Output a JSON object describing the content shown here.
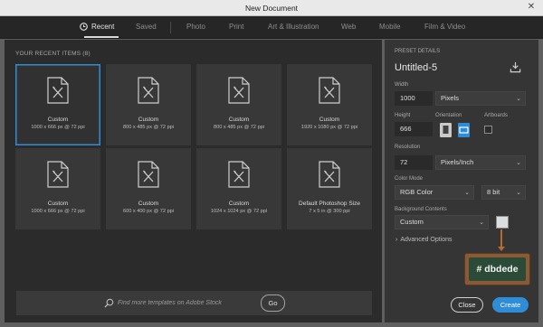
{
  "window": {
    "title": "New Document",
    "close_glyph": "✕"
  },
  "tabs": [
    {
      "label": "Recent",
      "icon": "clock-icon",
      "active": true
    },
    {
      "label": "Saved"
    },
    {
      "label": "Photo"
    },
    {
      "label": "Print"
    },
    {
      "label": "Art & Illustration"
    },
    {
      "label": "Web"
    },
    {
      "label": "Mobile"
    },
    {
      "label": "Film & Video"
    }
  ],
  "recent": {
    "header": "YOUR RECENT ITEMS  (8)",
    "items": [
      {
        "name": "Custom",
        "details": "1000 x 666 px @ 72 ppi",
        "selected": true,
        "icon": "document-icon"
      },
      {
        "name": "Custom",
        "details": "800 x 485 px @ 72 ppi",
        "icon": "document-icon"
      },
      {
        "name": "Custom",
        "details": "800 x 485 px @ 72 ppi",
        "icon": "document-icon"
      },
      {
        "name": "Custom",
        "details": "1920 x 1080 px @ 72 ppi",
        "icon": "document-icon"
      },
      {
        "name": "Custom",
        "details": "1000 x 666 px @ 72 ppi",
        "icon": "document-icon"
      },
      {
        "name": "Custom",
        "details": "600 x 400 px @ 72 ppi",
        "icon": "document-icon"
      },
      {
        "name": "Custom",
        "details": "1024 x 1024 px @ 72 ppi",
        "icon": "document-icon"
      },
      {
        "name": "Default Photoshop Size",
        "details": "7 x 5 in @ 300 ppi",
        "icon": "document-icon"
      }
    ]
  },
  "search": {
    "placeholder": "Find more templates on Adobe Stock",
    "value": "",
    "go_label": "Go"
  },
  "preset": {
    "section_label": "PRESET DETAILS",
    "name": "Untitled-5",
    "width_label": "Width",
    "width_value": "1000",
    "width_unit": "Pixels",
    "height_label": "Height",
    "height_value": "666",
    "orientation_label": "Orientation",
    "artboards_label": "Artboards",
    "resolution_label": "Resolution",
    "resolution_value": "72",
    "resolution_unit": "Pixels/Inch",
    "color_mode_label": "Color Mode",
    "color_mode_value": "RGB Color",
    "bit_depth": "8 bit",
    "background_label": "Background Contents",
    "background_value": "Custom",
    "background_color": "#dbdede",
    "advanced_label": "Advanced Options"
  },
  "callout": {
    "text": "# dbdede"
  },
  "buttons": {
    "close_label": "Close",
    "create_label": "Create"
  },
  "colors": {
    "accent": "#2f8dd8",
    "callout_frame": "#8a5a36",
    "callout_fill": "#2b4a38"
  }
}
